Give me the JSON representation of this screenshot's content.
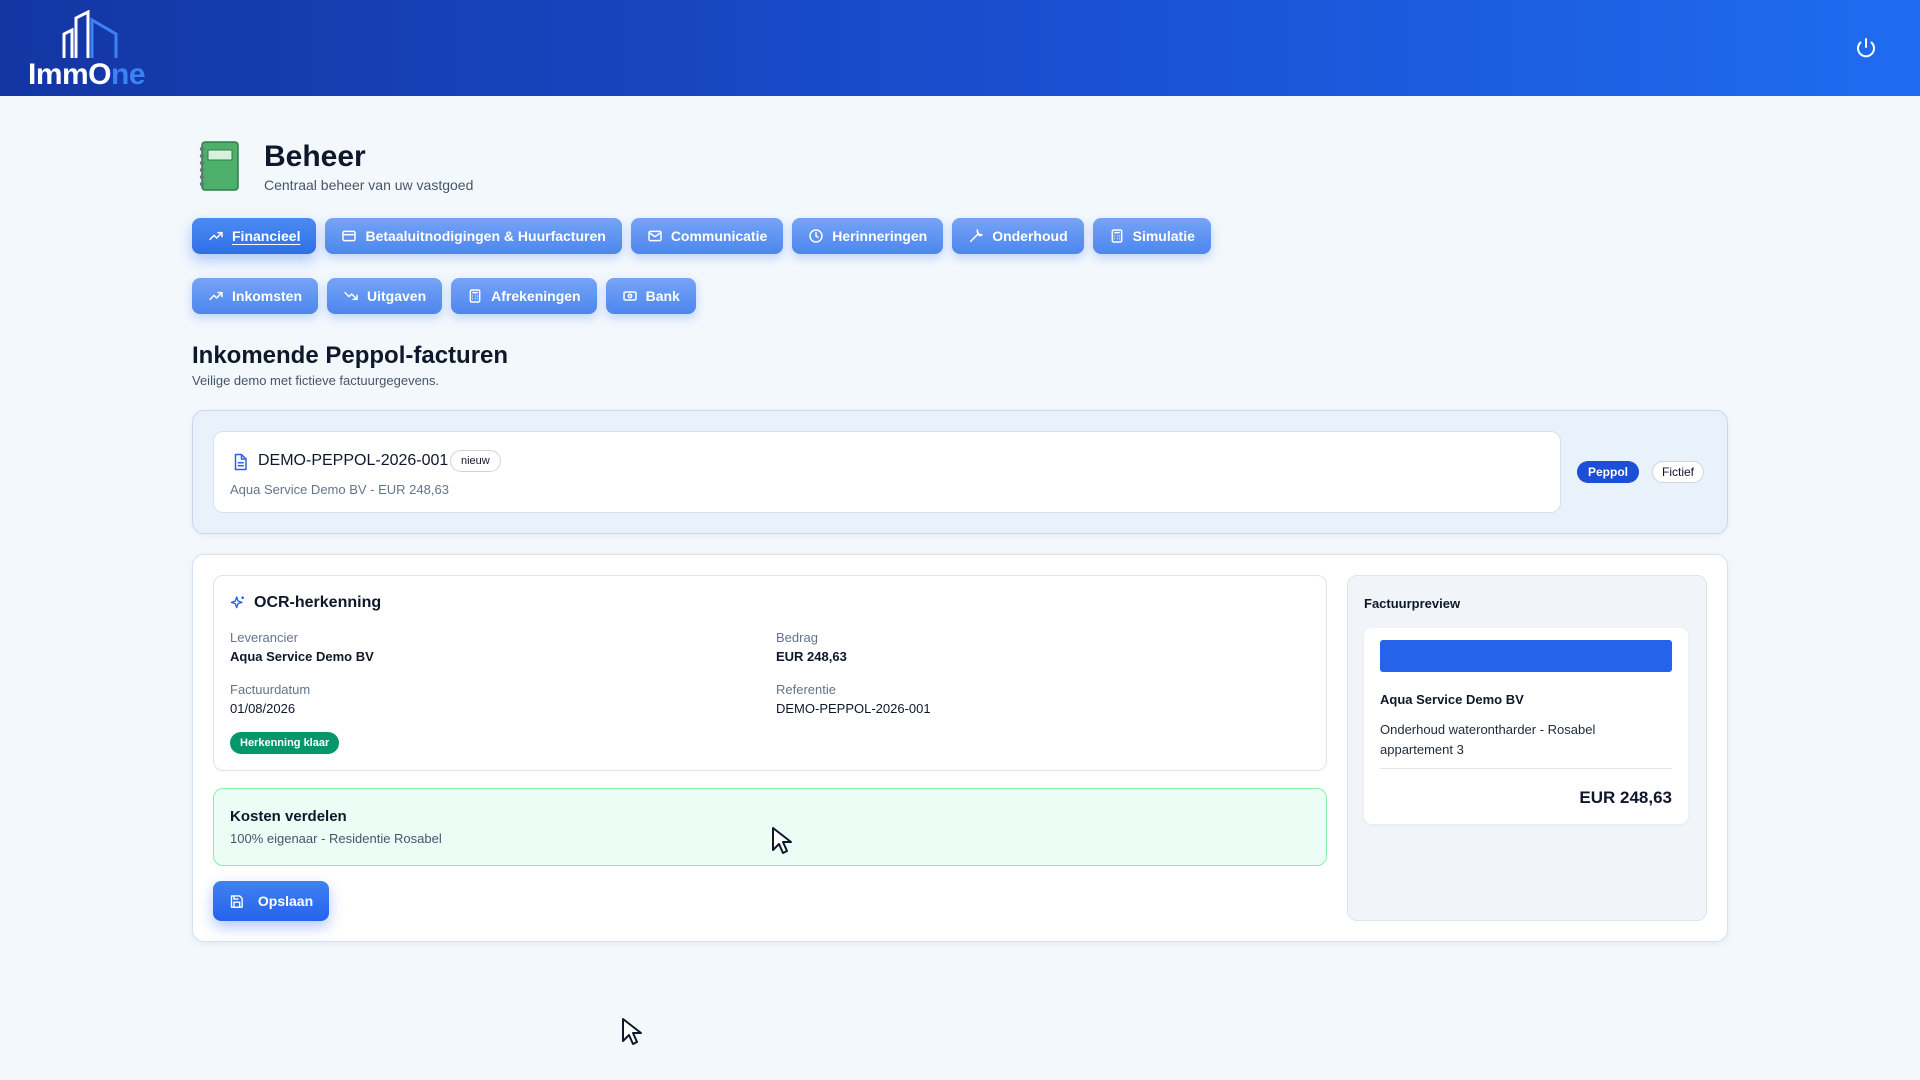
{
  "brand": {
    "logo_text_a": "ImmO",
    "logo_text_b": "ne",
    "accent": "#2563eb"
  },
  "header": {
    "power_icon": "power-icon"
  },
  "page": {
    "title": "Beheer",
    "subtitle": "Centraal beheer van uw vastgoed",
    "icon": "notebook-icon"
  },
  "main_tabs": [
    {
      "label": "Financieel",
      "icon": "trending-up-icon",
      "active": true
    },
    {
      "label": "Betaaluitnodigingen & Huurfacturen",
      "icon": "credit-card-icon",
      "active": false
    },
    {
      "label": "Communicatie",
      "icon": "mail-icon",
      "active": false
    },
    {
      "label": "Herinneringen",
      "icon": "clock-icon",
      "active": false
    },
    {
      "label": "Onderhoud",
      "icon": "wrench-icon",
      "active": false
    },
    {
      "label": "Simulatie",
      "icon": "calculator-icon",
      "active": false
    }
  ],
  "sub_tabs": [
    {
      "label": "Inkomsten",
      "icon": "trending-up-icon"
    },
    {
      "label": "Uitgaven",
      "icon": "trending-down-icon"
    },
    {
      "label": "Afrekeningen",
      "icon": "calculator-icon"
    },
    {
      "label": "Bank",
      "icon": "banknote-icon"
    }
  ],
  "section": {
    "title": "Inkomende Peppol-facturen",
    "subtitle": "Veilige demo met fictieve factuurgegevens."
  },
  "invoice": {
    "number": "DEMO-PEPPOL-2026-001",
    "badge": "nieuw",
    "meta": "Aqua Service Demo BV - EUR 248,63",
    "pill_channel": "Peppol",
    "pill_type": "Fictief",
    "icon": "file-text-icon"
  },
  "ocr": {
    "title": "OCR-herkenning",
    "icon": "sparkles-icon",
    "supplier_label": "Leverancier",
    "supplier_value": "Aqua Service Demo BV",
    "amount_label": "Bedrag",
    "amount_value": "EUR 248,63",
    "date_label": "Factuurdatum",
    "date_value": "01/08/2026",
    "reference_label": "Referentie",
    "reference_value": "DEMO-PEPPOL-2026-001",
    "status": "Herkenning klaar",
    "status_color": "#059669"
  },
  "split": {
    "title": "Kosten verdelen",
    "subtitle": "100% eigenaar - Residentie Rosabel"
  },
  "actions": {
    "save_label": "Opslaan",
    "save_icon": "save-icon"
  },
  "preview": {
    "title": "Factuurpreview",
    "supplier": "Aqua Service Demo BV",
    "description": "Onderhoud waterontharder - Rosabel appartement 3",
    "amount": "EUR 248,63"
  }
}
